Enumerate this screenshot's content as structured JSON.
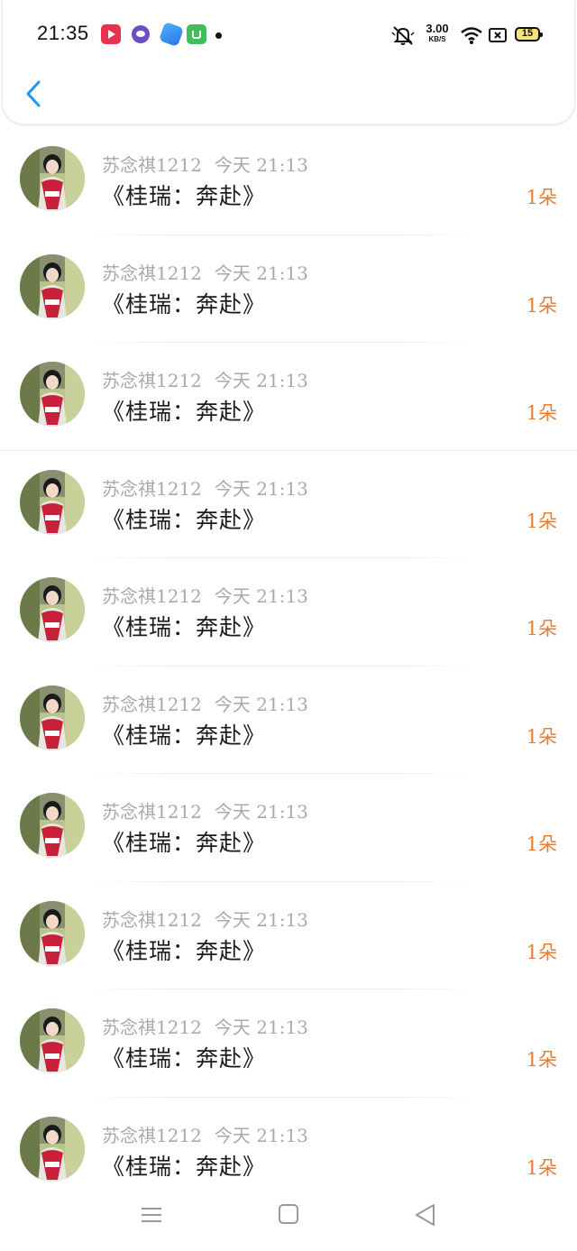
{
  "status_bar": {
    "time": "21:35",
    "net_speed_value": "3.00",
    "net_speed_unit": "KB/S",
    "battery_level": "15"
  },
  "nav": {
    "back_icon": "chevron-left-icon"
  },
  "colors": {
    "accent": "#2196f3",
    "count_orange": "#ee7c2d",
    "meta_gray": "#a9a9a9",
    "title_text": "#1a1a1a"
  },
  "items": [
    {
      "user": "苏念祺1212",
      "time": "今天 21:13",
      "title": "《桂瑞：奔赴》",
      "count": "1朵"
    },
    {
      "user": "苏念祺1212",
      "time": "今天 21:13",
      "title": "《桂瑞：奔赴》",
      "count": "1朵"
    },
    {
      "user": "苏念祺1212",
      "time": "今天 21:13",
      "title": "《桂瑞：奔赴》",
      "count": "1朵"
    },
    {
      "user": "苏念祺1212",
      "time": "今天 21:13",
      "title": "《桂瑞：奔赴》",
      "count": "1朵"
    },
    {
      "user": "苏念祺1212",
      "time": "今天 21:13",
      "title": "《桂瑞：奔赴》",
      "count": "1朵"
    },
    {
      "user": "苏念祺1212",
      "time": "今天 21:13",
      "title": "《桂瑞：奔赴》",
      "count": "1朵"
    },
    {
      "user": "苏念祺1212",
      "time": "今天 21:13",
      "title": "《桂瑞：奔赴》",
      "count": "1朵"
    },
    {
      "user": "苏念祺1212",
      "time": "今天 21:13",
      "title": "《桂瑞：奔赴》",
      "count": "1朵"
    },
    {
      "user": "苏念祺1212",
      "time": "今天 21:13",
      "title": "《桂瑞：奔赴》",
      "count": "1朵"
    },
    {
      "user": "苏念祺1212",
      "time": "今天 21:13",
      "title": "《桂瑞：奔赴》",
      "count": "1朵"
    }
  ],
  "bottom_nav": {
    "menu_icon": "menu-icon",
    "home_icon": "square-home-icon",
    "back_icon": "triangle-back-icon"
  }
}
